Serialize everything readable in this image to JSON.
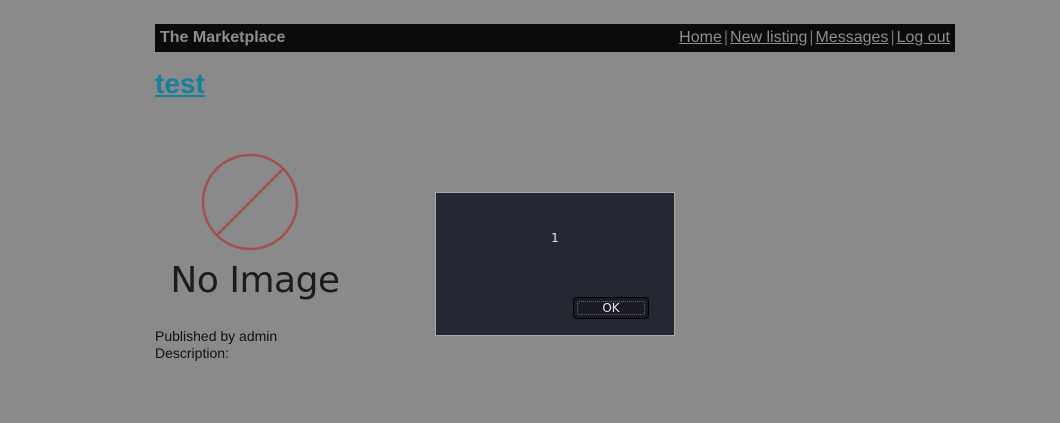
{
  "header": {
    "site_title": "The Marketplace",
    "nav": [
      {
        "label": "Home"
      },
      {
        "label": "New listing"
      },
      {
        "label": "Messages"
      },
      {
        "label": "Log out"
      }
    ],
    "separator": "|"
  },
  "listing": {
    "title": "test",
    "image_placeholder_text": "No Image",
    "published_by": "Published by admin",
    "description_label": "Description:"
  },
  "dialog": {
    "message": "1",
    "ok_label": "OK"
  },
  "colors": {
    "background": "#8a8a8a",
    "header_bg": "#0b0b0b",
    "title_link": "#177f9e",
    "dialog_bg": "#252732",
    "no_image_circle": "#a4504a"
  }
}
